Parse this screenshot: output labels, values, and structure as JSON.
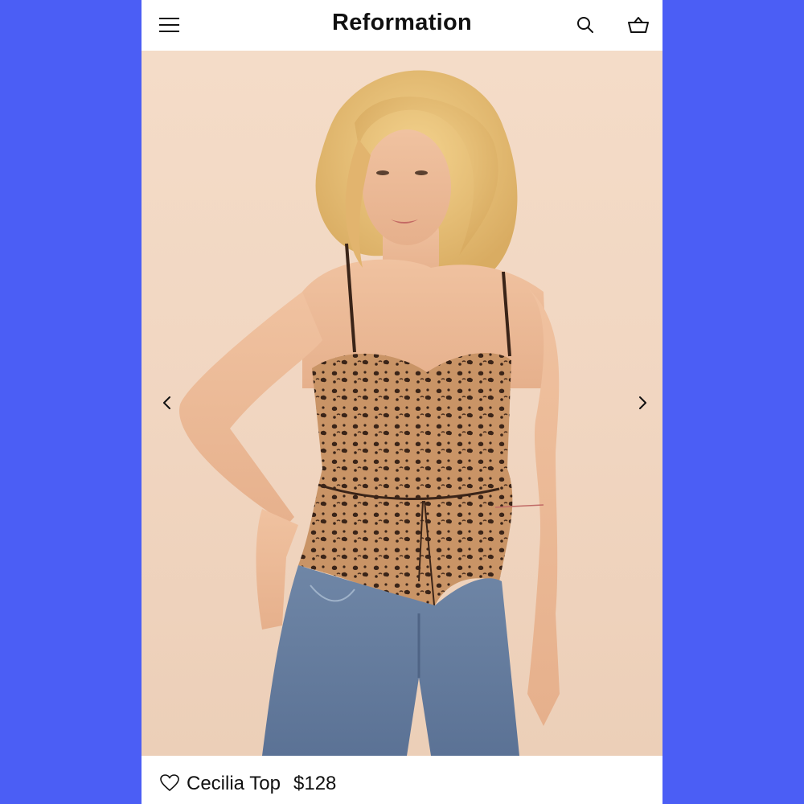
{
  "header": {
    "brand": "Reformation",
    "menu_icon": "hamburger-menu-icon",
    "search_icon": "search-icon",
    "cart_icon": "shopping-basket-icon"
  },
  "gallery": {
    "image_alt": "Model wearing leopard print Cecilia Top with jeans",
    "prev_icon": "chevron-left-icon",
    "next_icon": "chevron-right-icon"
  },
  "product": {
    "wishlist_icon": "heart-icon",
    "name": "Cecilia Top",
    "price": "$128"
  },
  "colors": {
    "frame_background": "#4b5ef5",
    "page_background": "#ffffff",
    "hero_background": "#f3d9c5",
    "text": "#111111"
  }
}
